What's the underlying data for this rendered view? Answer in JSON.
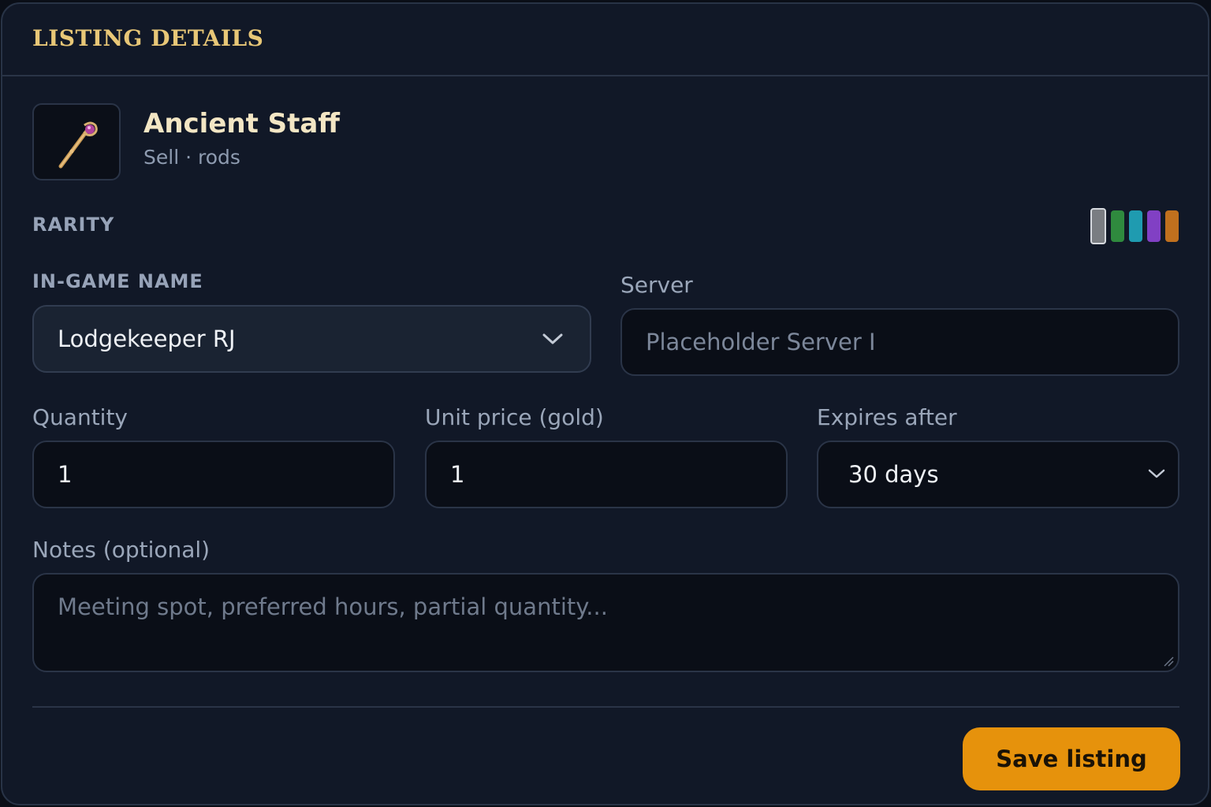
{
  "panel": {
    "title": "LISTING DETAILS"
  },
  "item": {
    "name": "Ancient Staff",
    "subtitle": "Sell · rods",
    "icon": "staff-icon"
  },
  "rarity": {
    "label": "RARITY",
    "options": [
      {
        "color": "#7a7d82",
        "selected": true
      },
      {
        "color": "#2f8a3e",
        "selected": false
      },
      {
        "color": "#1f9bb0",
        "selected": false
      },
      {
        "color": "#8140c4",
        "selected": false
      },
      {
        "color": "#c0701e",
        "selected": false
      }
    ]
  },
  "ign": {
    "label": "IN-GAME NAME",
    "value": "Lodgekeeper RJ"
  },
  "server": {
    "label": "Server",
    "placeholder": "Placeholder Server I"
  },
  "quantity": {
    "label": "Quantity",
    "value": "1"
  },
  "unit_price": {
    "label": "Unit price (gold)",
    "value": "1"
  },
  "expires": {
    "label": "Expires after",
    "value": "30 days"
  },
  "notes": {
    "label": "Notes (optional)",
    "placeholder": "Meeting spot, preferred hours, partial quantity..."
  },
  "actions": {
    "save_label": "Save listing"
  },
  "colors": {
    "accent": "#e6920c",
    "title_gold": "#e8c777"
  }
}
